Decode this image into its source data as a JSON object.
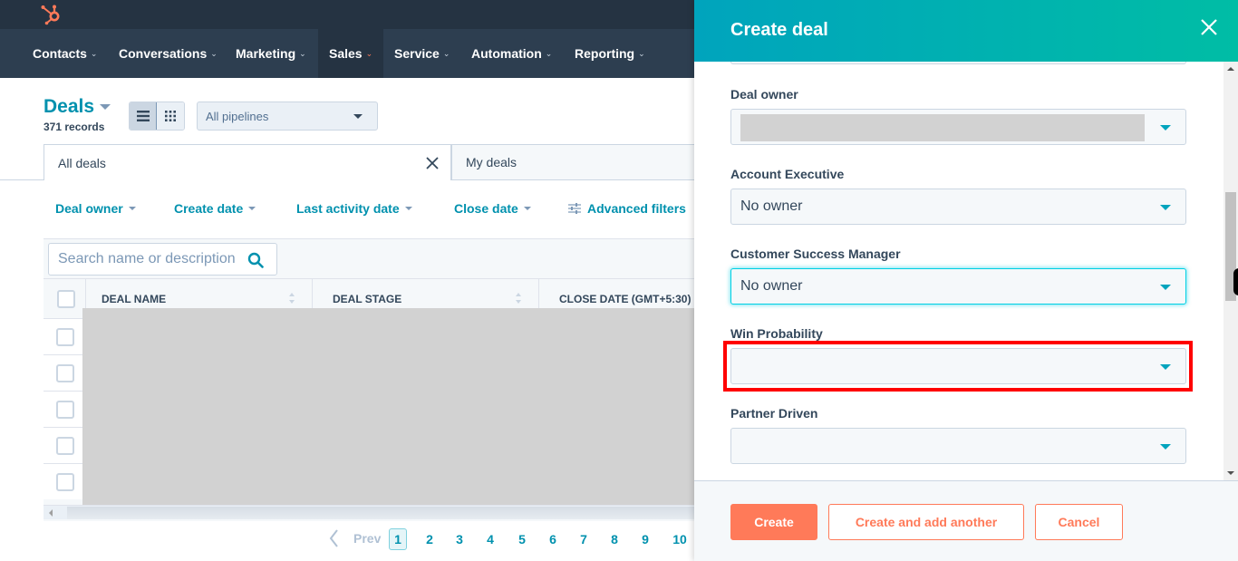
{
  "nav": {
    "logo": "hubspot-logo",
    "items": [
      {
        "label": "Contacts",
        "active": false
      },
      {
        "label": "Conversations",
        "active": false
      },
      {
        "label": "Marketing",
        "active": false
      },
      {
        "label": "Sales",
        "active": true
      },
      {
        "label": "Service",
        "active": false
      },
      {
        "label": "Automation",
        "active": false
      },
      {
        "label": "Reporting",
        "active": false
      }
    ]
  },
  "header": {
    "title": "Deals",
    "record_count": "371 records",
    "pipeline_select": "All pipelines"
  },
  "views": {
    "tabs": [
      {
        "label": "All deals",
        "active": true,
        "closable": true
      },
      {
        "label": "My deals",
        "active": false
      }
    ]
  },
  "filters": [
    {
      "label": "Deal owner"
    },
    {
      "label": "Create date"
    },
    {
      "label": "Last activity date"
    },
    {
      "label": "Close date"
    },
    {
      "label": "Advanced filters",
      "icon": "sliders-icon"
    }
  ],
  "table": {
    "search_placeholder": "Search name or description",
    "columns": [
      "DEAL NAME",
      "DEAL STAGE",
      "CLOSE DATE (GMT+5:30)"
    ],
    "row_count_visible": 5
  },
  "pagination": {
    "prev_label": "Prev",
    "pages": [
      "1",
      "2",
      "3",
      "4",
      "5",
      "6",
      "7",
      "8",
      "9",
      "10"
    ],
    "current": "1"
  },
  "panel": {
    "title": "Create deal",
    "fields": [
      {
        "label": "Deal owner",
        "value": "",
        "redacted": true
      },
      {
        "label": "Account Executive",
        "value": "No owner"
      },
      {
        "label": "Customer Success Manager",
        "value": "No owner",
        "focused": true
      },
      {
        "label": "Win Probability",
        "value": "",
        "highlighted": true
      },
      {
        "label": "Partner Driven",
        "value": ""
      }
    ],
    "buttons": {
      "create": "Create",
      "create_another": "Create and add another",
      "cancel": "Cancel"
    }
  },
  "colors": {
    "accent": "#0091ae",
    "brand_orange": "#ff7a59",
    "nav_bg": "#2d3e50",
    "highlight": "#ff0000"
  }
}
